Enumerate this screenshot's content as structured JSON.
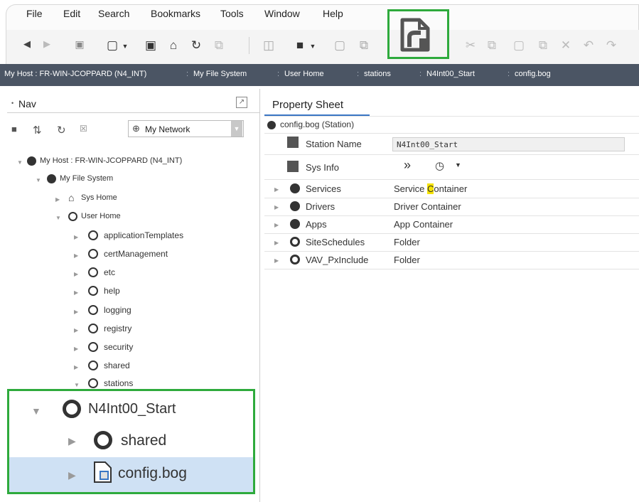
{
  "menu": [
    "File",
    "Edit",
    "Search",
    "Bookmarks",
    "Tools",
    "Window",
    "Help"
  ],
  "toolbar": {
    "icons": [
      "back-icon",
      "forward-icon",
      "home-view-icon",
      "window-icon",
      "tab-icon",
      "home-icon",
      "refresh-icon",
      "copy-view-icon",
      "side-bar-icon",
      "folder-icon",
      "save-icon",
      "save-all-icon",
      "new-file-icon",
      "cut-icon",
      "copy-icon",
      "paste-icon",
      "duplicate-icon",
      "delete-icon",
      "undo-icon",
      "redo-icon"
    ],
    "highlighted_icon": "open-file-icon"
  },
  "breadcrumb": [
    "My Host : FR-WIN-JCOPPARD (N4_INT)",
    "My File System",
    "User Home",
    "stations",
    "N4Int00_Start",
    "config.bog"
  ],
  "nav": {
    "title": "Nav",
    "network_select": "My Network",
    "tree": {
      "host": "My Host : FR-WIN-JCOPPARD (N4_INT)",
      "file_system": "My File System",
      "sys_home": "Sys Home",
      "user_home": "User Home",
      "user_home_children": [
        "applicationTemplates",
        "certManagement",
        "etc",
        "help",
        "logging",
        "registry",
        "security",
        "shared",
        "stations"
      ],
      "station": "N4Int00_Start",
      "station_children": [
        "shared",
        "config.bog"
      ]
    }
  },
  "property_sheet": {
    "tab": "Property Sheet",
    "header": "config.bog  (Station)",
    "station_name_label": "Station Name",
    "station_name_value": "N4Int00_Start",
    "sys_info_label": "Sys Info",
    "rows": [
      {
        "name": "Services",
        "value_pre": "Service ",
        "value_hl": "C",
        "value_post": "ontainer"
      },
      {
        "name": "Drivers",
        "value": "Driver Container"
      },
      {
        "name": "Apps",
        "value": "App Container"
      },
      {
        "name": "SiteSchedules",
        "value": "Folder"
      },
      {
        "name": "VAV_PxInclude",
        "value": "Folder"
      }
    ]
  },
  "colors": {
    "highlight_green": "#2eaa3c",
    "selection_blue": "#cfe1f4",
    "breadcrumb_bg": "#4b5564",
    "text_highlight": "#f5e200"
  }
}
